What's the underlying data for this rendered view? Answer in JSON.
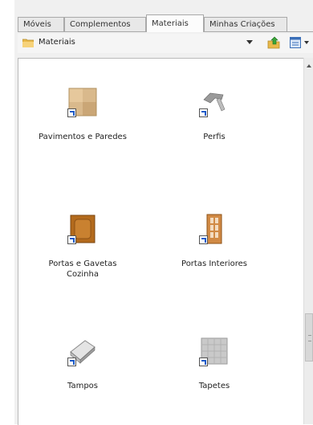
{
  "tabs": [
    {
      "label": "Móveis"
    },
    {
      "label": "Complementos"
    },
    {
      "label": "Materiais"
    },
    {
      "label": "Minhas Criações"
    }
  ],
  "toolbar": {
    "path": "Materiais",
    "folder_icon": "folder-icon",
    "up_icon": "up-folder-icon",
    "view_icon": "view-mode-icon"
  },
  "items": [
    {
      "label": "Pavimentos e Paredes",
      "icon": "floor-wall-material-icon"
    },
    {
      "label": "Perfis",
      "icon": "profile-material-icon"
    },
    {
      "label": "Portas e Gavetas\nCozinha",
      "icon": "kitchen-door-material-icon"
    },
    {
      "label": "Portas Interiores",
      "icon": "interior-door-material-icon"
    },
    {
      "label": "Tampos",
      "icon": "countertop-material-icon"
    },
    {
      "label": "Tapetes",
      "icon": "rug-material-icon"
    }
  ],
  "colors": {
    "accent": "#1c5bc9",
    "folder": "#e9b94a"
  }
}
